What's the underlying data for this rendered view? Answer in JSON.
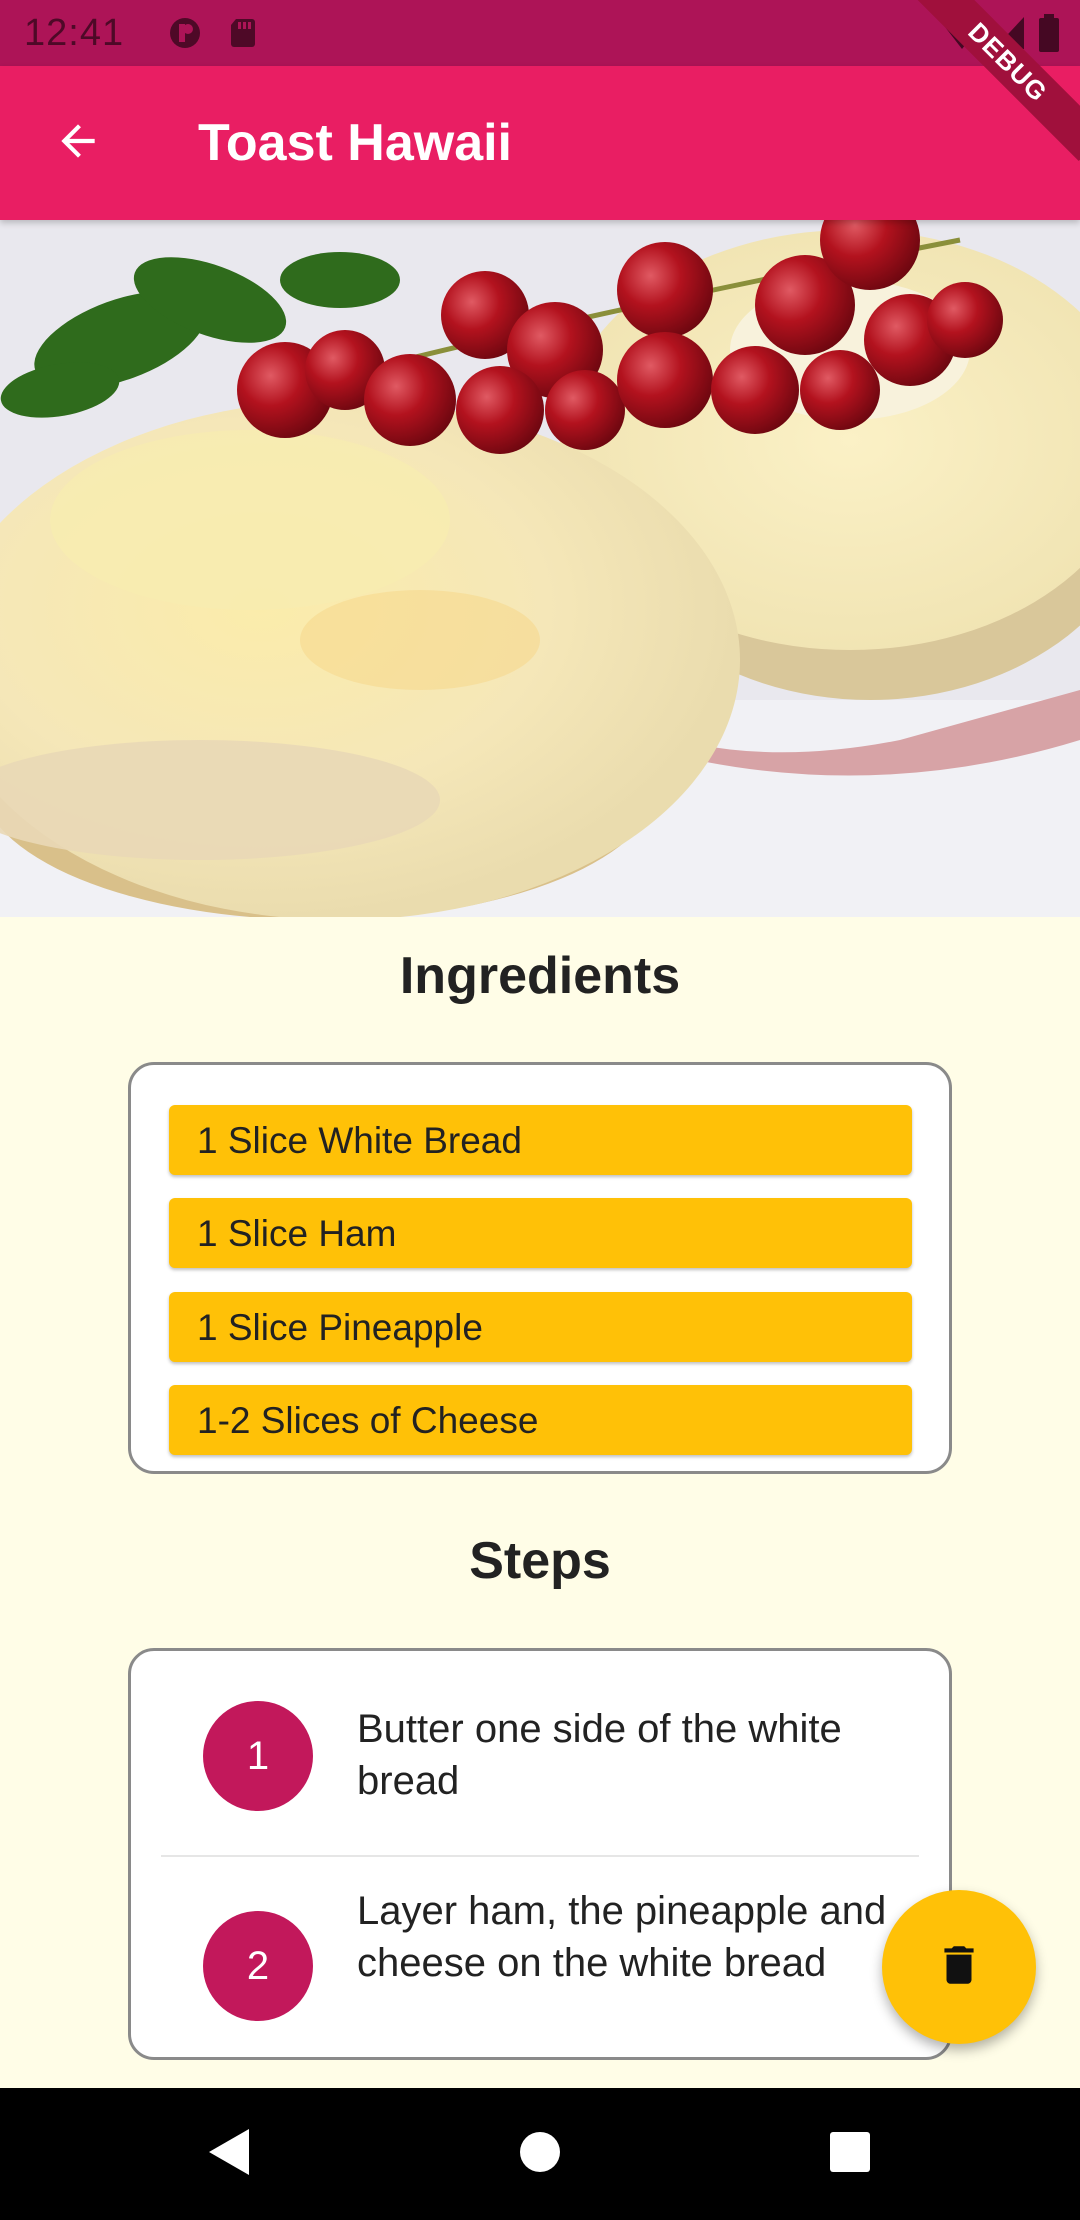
{
  "status_bar": {
    "time": "12:41",
    "icons_left": [
      "profile-badge-icon",
      "sd-card-icon"
    ],
    "icons_right": [
      "wifi-icon",
      "signal-icon",
      "battery-icon"
    ]
  },
  "debug_banner": "DEBUG",
  "app_bar": {
    "title": "Toast Hawaii",
    "back_icon": "arrow-back-icon",
    "color": "#e91e63"
  },
  "ingredients": {
    "title": "Ingredients",
    "items": [
      "1 Slice White Bread",
      "1 Slice Ham",
      "1 Slice Pineapple",
      "1-2 Slices of Cheese"
    ],
    "item_color": "#ffc107"
  },
  "steps": {
    "title": "Steps",
    "items": [
      {
        "number": "1",
        "text": "Butter one side of the white bread"
      },
      {
        "number": "2",
        "text": "Layer ham, the pineapple and cheese on the white bread"
      }
    ],
    "badge_color": "#c2185b"
  },
  "fab": {
    "icon": "delete-icon",
    "color": "#ffc107"
  },
  "nav": {
    "icons": [
      "back-triangle-icon",
      "home-circle-icon",
      "recents-square-icon"
    ]
  }
}
